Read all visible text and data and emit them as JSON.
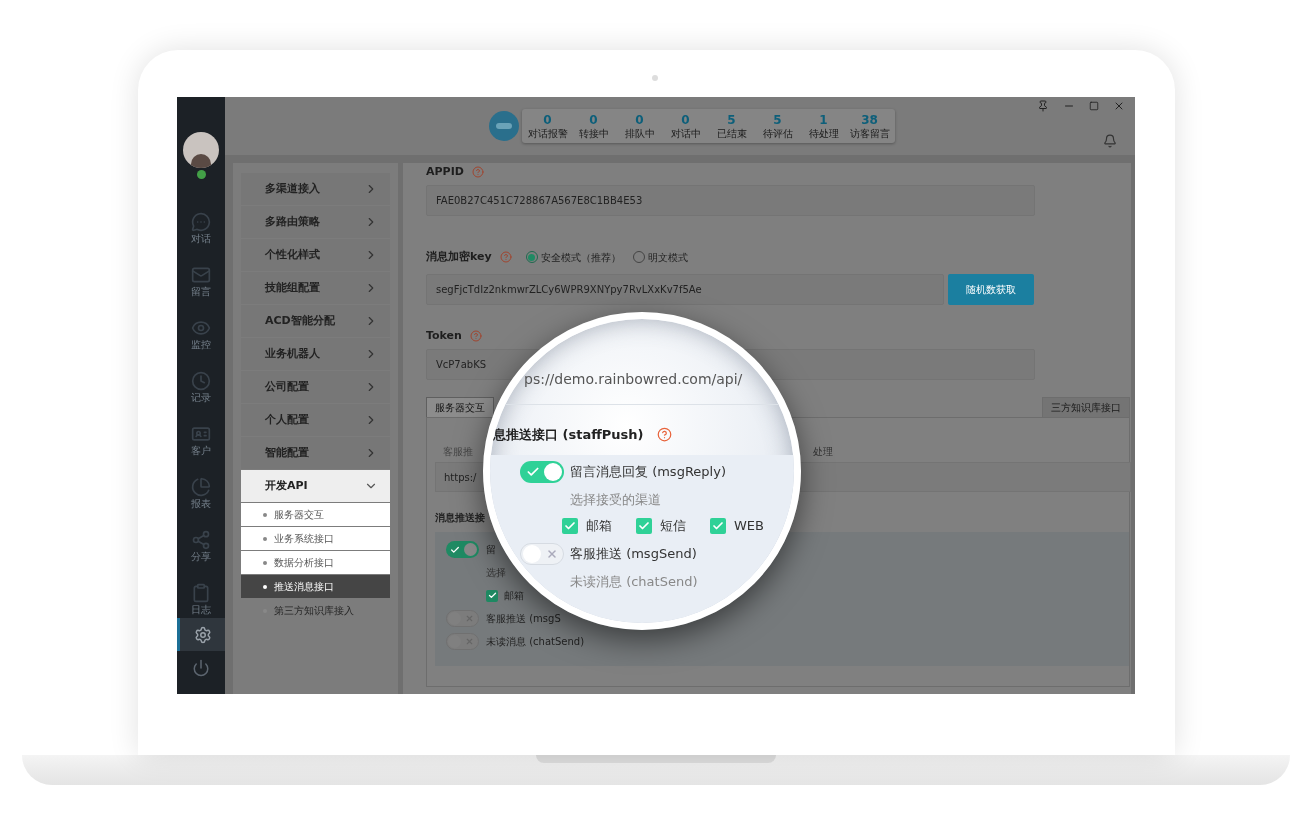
{
  "user": {
    "online": true
  },
  "nav": {
    "items": [
      {
        "kind": "chat",
        "label": "对话"
      },
      {
        "kind": "mail",
        "label": "留言"
      },
      {
        "kind": "eye",
        "label": "监控"
      },
      {
        "kind": "clock",
        "label": "记录"
      },
      {
        "kind": "card",
        "label": "客户"
      },
      {
        "kind": "pie",
        "label": "报表"
      },
      {
        "kind": "share",
        "label": "分享"
      },
      {
        "kind": "clipboard",
        "label": "日志"
      }
    ],
    "bottom": [
      {
        "kind": "settings",
        "selected": true
      },
      {
        "kind": "power",
        "selected": false
      }
    ]
  },
  "stats": [
    {
      "value": "0",
      "label": "对话报警"
    },
    {
      "value": "0",
      "label": "转接中"
    },
    {
      "value": "0",
      "label": "排队中"
    },
    {
      "value": "0",
      "label": "对话中"
    },
    {
      "value": "5",
      "label": "已结束"
    },
    {
      "value": "5",
      "label": "待评估"
    },
    {
      "value": "1",
      "label": "待处理"
    },
    {
      "value": "38",
      "label": "访客留言"
    }
  ],
  "settings_menu": [
    {
      "label": "多渠道接入",
      "expanded": false,
      "highlighted": false
    },
    {
      "label": "多路由策略",
      "expanded": false,
      "highlighted": false
    },
    {
      "label": "个性化样式",
      "expanded": false,
      "highlighted": false
    },
    {
      "label": "技能组配置",
      "expanded": false,
      "highlighted": false
    },
    {
      "label": "ACD智能分配",
      "expanded": false,
      "highlighted": false
    },
    {
      "label": "业务机器人",
      "expanded": false,
      "highlighted": false
    },
    {
      "label": "公司配置",
      "expanded": false,
      "highlighted": false
    },
    {
      "label": "个人配置",
      "expanded": false,
      "highlighted": false
    },
    {
      "label": "智能配置",
      "expanded": false,
      "highlighted": false
    },
    {
      "label": "开发API",
      "expanded": true,
      "highlighted": true,
      "children": [
        {
          "label": "服务器交互",
          "selected": false,
          "highlighted": true
        },
        {
          "label": "业务系统接口",
          "selected": false,
          "highlighted": true
        },
        {
          "label": "数据分析接口",
          "selected": false,
          "highlighted": true
        },
        {
          "label": "推送消息接口",
          "selected": true,
          "highlighted": true
        },
        {
          "label": "第三方知识库接入",
          "selected": false,
          "highlighted": false
        }
      ]
    }
  ],
  "form": {
    "appid": {
      "label": "APPID",
      "value": "FAE0B27C451C728867A567E8C1BB4E53"
    },
    "key": {
      "label": "消息加密key",
      "modes": [
        {
          "label": "安全模式（推荐）",
          "selected": true
        },
        {
          "label": "明文模式",
          "selected": false
        }
      ],
      "value": "segFjcTdIz2nkmwrZLCy6WPR9XNYpy7RvLXxKv7f5Ae",
      "button": "随机数获取"
    },
    "token": {
      "label": "Token",
      "value": "VcP7abKS"
    }
  },
  "tabs": [
    {
      "label": "服务器交互",
      "selected": true
    },
    {
      "label": "三方知识库接口",
      "selected": false
    }
  ],
  "tab_content": {
    "push_label": "客服推",
    "push_note": "处理",
    "url_value": "https:/",
    "section_title": "消息推送接",
    "rows": [
      {
        "kind": "toggle",
        "on": true,
        "label": "留"
      },
      {
        "kind": "hint",
        "label": "选择"
      },
      {
        "kind": "checkbox",
        "checked": true,
        "label": "邮箱"
      },
      {
        "kind": "toggle",
        "on": false,
        "label": "客服推送 (msgS"
      },
      {
        "kind": "toggle",
        "on": false,
        "label": "未读消息 (chatSend)"
      }
    ]
  },
  "magnifier": {
    "url": "ps://demo.rainbowred.com/api/",
    "title": "息推送接口 (staffPush)",
    "rows": [
      {
        "kind": "toggle",
        "on": true,
        "label": "留言消息回复 (msgReply)"
      },
      {
        "kind": "hint",
        "label": "选择接受的渠道"
      },
      {
        "kind": "checkboxes",
        "items": [
          {
            "label": "邮箱",
            "checked": true
          },
          {
            "label": "短信",
            "checked": true
          },
          {
            "label": "WEB",
            "checked": true
          }
        ]
      },
      {
        "kind": "toggle",
        "on": false,
        "label": "客服推送 (msgSend)"
      },
      {
        "kind": "hint",
        "label": "未读消息 (chatSend)"
      }
    ]
  }
}
